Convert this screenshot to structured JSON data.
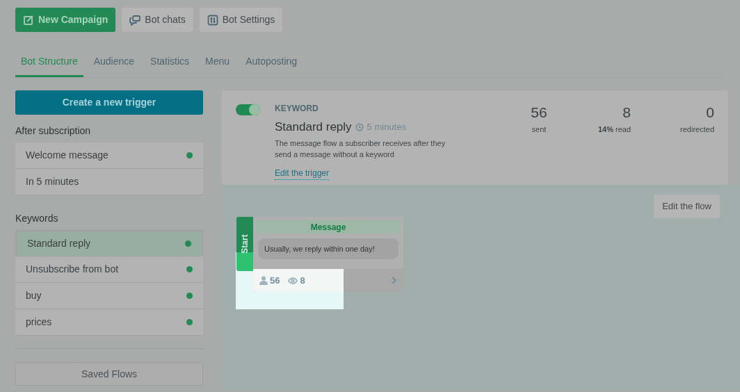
{
  "toolbar": [
    {
      "label": "New Campaign",
      "kind": "primary"
    },
    {
      "label": "Bot chats",
      "kind": "chats"
    },
    {
      "label": "Bot Settings",
      "kind": "settings"
    }
  ],
  "tabs": [
    {
      "label": "Bot Structure",
      "selected": true
    },
    {
      "label": "Audience",
      "selected": false
    },
    {
      "label": "Statistics",
      "selected": false
    },
    {
      "label": "Menu",
      "selected": false
    },
    {
      "label": "Autoposting",
      "selected": false
    }
  ],
  "sidebar": {
    "create_button": "Create a new trigger",
    "sections": [
      {
        "title": "After subscription",
        "items": [
          {
            "label": "Welcome message",
            "selected": false,
            "active": true
          },
          {
            "label": "In 5 minutes",
            "selected": false,
            "active": false
          }
        ]
      },
      {
        "title": "Keywords",
        "items": [
          {
            "label": "Standard reply",
            "selected": true,
            "active": true
          },
          {
            "label": "Unsubscribe from bot",
            "selected": false,
            "active": true
          },
          {
            "label": "buy",
            "selected": false,
            "active": true
          },
          {
            "label": "prices",
            "selected": false,
            "active": true
          }
        ]
      }
    ],
    "saved_flows_button": "Saved Flows"
  },
  "trigger": {
    "on": true,
    "type": "KEYWORD",
    "title": "Standard reply",
    "delay": "5 minutes",
    "description": "The message flow a subscriber receives after they send a message without a keyword",
    "edit_link": "Edit the trigger",
    "stats": [
      {
        "value": "56",
        "label": "sent"
      },
      {
        "value": "8",
        "label": "**14%** read"
      },
      {
        "value": "0",
        "label": "redirected"
      }
    ]
  },
  "flow": {
    "edit_button": "Edit the flow",
    "start_label": "Start",
    "node": {
      "title": "Message",
      "message": "Usually, we reply within one day!",
      "subscribers": "56",
      "views": "8"
    }
  }
}
